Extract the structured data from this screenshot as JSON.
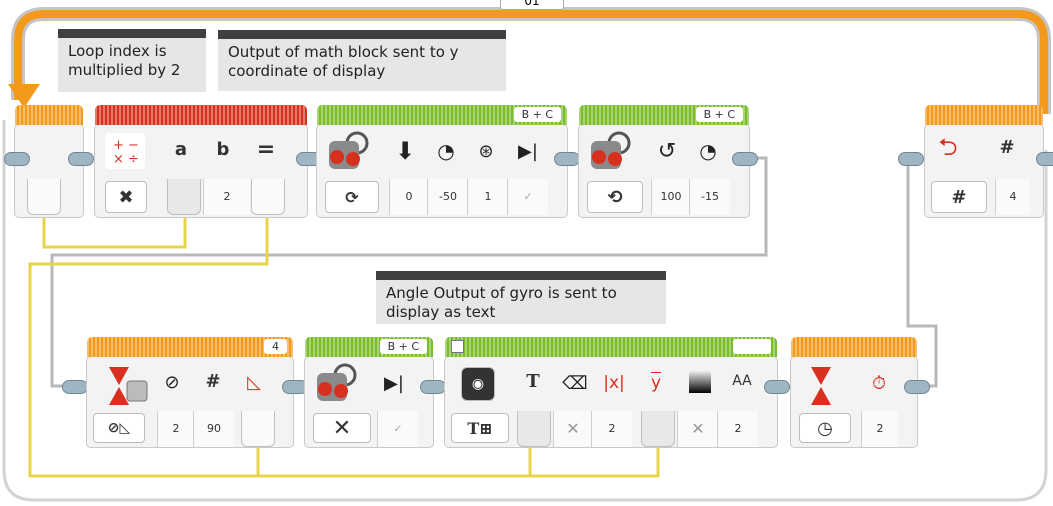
{
  "loop": {
    "top_label": "01"
  },
  "comments": {
    "loop_index": "Loop index is\nmultiplied by 2",
    "math_output": "Output of math block sent to y\ncoordinate of display",
    "gyro_output": "Angle Output of gyro is sent to\ndisplay as text"
  },
  "math_block": {
    "param_a": "a",
    "param_b": "b",
    "param_eq": "=",
    "b_value": "2",
    "mode_symbol": "✖"
  },
  "steer_block_1": {
    "ports": "B + C",
    "values": [
      "0",
      "-50",
      "1"
    ]
  },
  "steer_block_2": {
    "ports": "B + C",
    "values": [
      "100",
      "-15"
    ]
  },
  "loop_interrupt": {
    "param_hash": "#",
    "value": "4",
    "mode_symbol": "#"
  },
  "wait_gyro": {
    "port": "4",
    "param_hash": "#",
    "values": [
      "2",
      "90"
    ]
  },
  "steer_block_3": {
    "ports": "B + C"
  },
  "display_block": {
    "param_t": "T",
    "values": [
      "2",
      "2"
    ],
    "font_label": "AA"
  },
  "wait_timer": {
    "value": "2"
  }
}
